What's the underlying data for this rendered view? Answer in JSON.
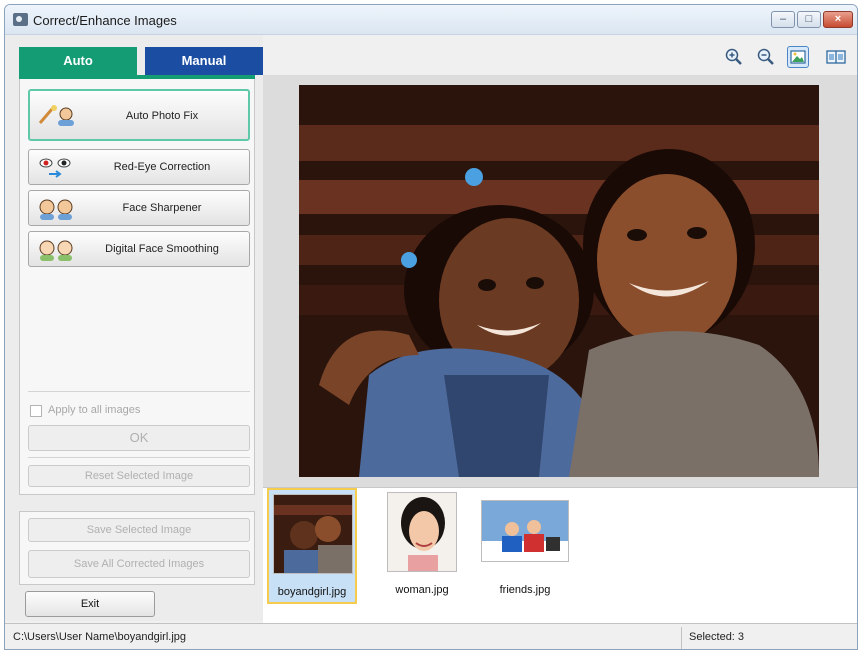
{
  "window": {
    "title": "Correct/Enhance Images",
    "controls": {
      "minimize": "–",
      "maximize": "□",
      "close": "×"
    }
  },
  "tabs": [
    {
      "label": "Auto",
      "active": true,
      "color": "#149c74"
    },
    {
      "label": "Manual",
      "active": false,
      "color": "#1b4ea3"
    }
  ],
  "functions": [
    {
      "label": "Auto Photo Fix",
      "icon": "auto-photo-fix-icon",
      "selected": true
    },
    {
      "label": "Red-Eye Correction",
      "icon": "red-eye-icon",
      "selected": false
    },
    {
      "label": "Face Sharpener",
      "icon": "face-sharpener-icon",
      "selected": false
    },
    {
      "label": "Digital Face Smoothing",
      "icon": "face-smoothing-icon",
      "selected": false
    }
  ],
  "options": {
    "apply_all_label": "Apply to all images",
    "apply_all_checked": false,
    "ok_label": "OK",
    "reset_label": "Reset Selected Image"
  },
  "save": {
    "save_selected_label": "Save Selected Image",
    "save_all_label": "Save All Corrected Images"
  },
  "exit_label": "Exit",
  "toolbar": {
    "zoom_in_icon": "zoom-in-icon",
    "zoom_out_icon": "zoom-out-icon",
    "single_view_icon": "single-view-icon",
    "compare_view_icon": "compare-view-icon",
    "active_view": "single"
  },
  "thumbnails": [
    {
      "name": "boyandgirl.jpg",
      "selected": true
    },
    {
      "name": "woman.jpg",
      "selected": false
    },
    {
      "name": "friends.jpg",
      "selected": false
    }
  ],
  "status": {
    "path": "C:\\Users\\User Name\\boyandgirl.jpg",
    "selected": "Selected: 3"
  },
  "colors": {
    "accent_auto": "#149c74",
    "accent_manual": "#1b4ea3",
    "selection_border": "#f5cc4c"
  }
}
